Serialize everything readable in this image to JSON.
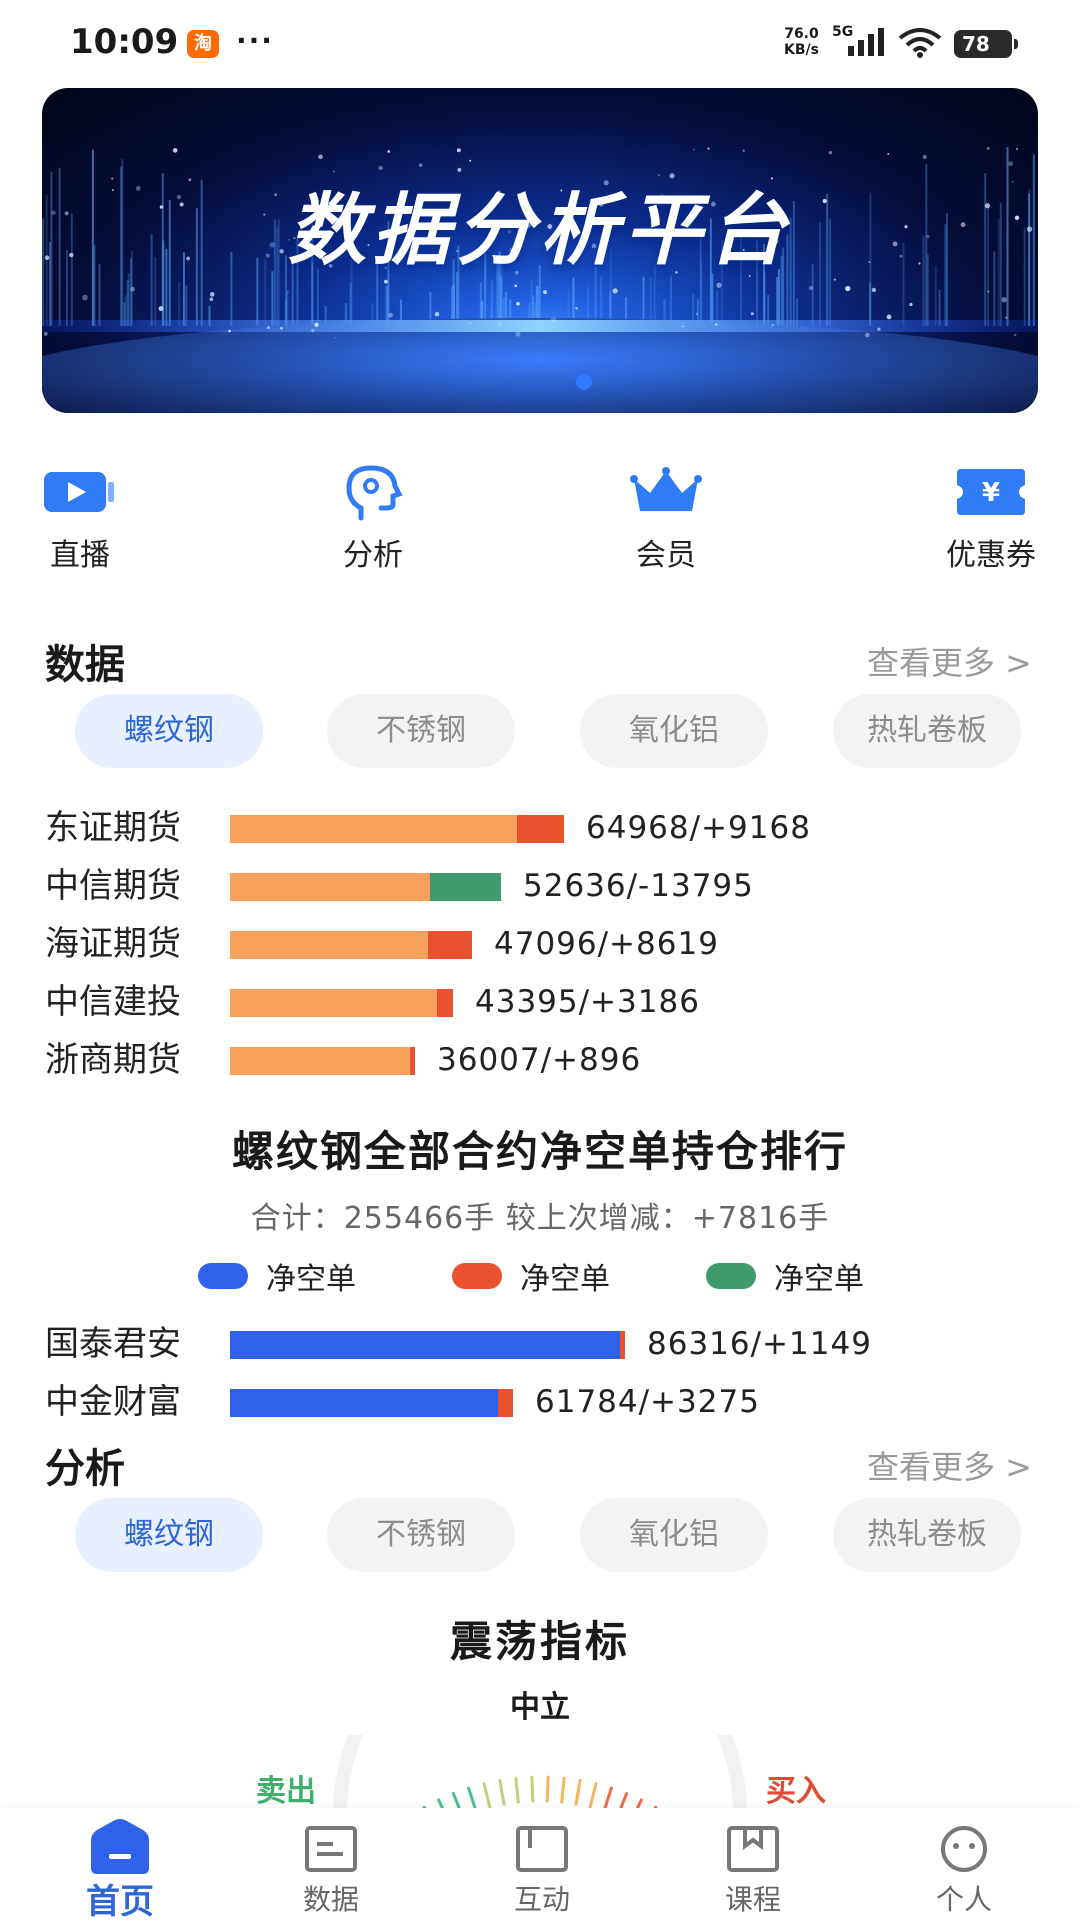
{
  "status_bar": {
    "time": "10:09",
    "app_badge": "淘",
    "more": "···",
    "net_speed": "76.0",
    "net_unit": "KB/s",
    "net_type": "5G",
    "battery": "78"
  },
  "banner": {
    "title": "数据分析平台"
  },
  "quick_actions": [
    {
      "label": "直播",
      "icon": "live-video-icon"
    },
    {
      "label": "分析",
      "icon": "analysis-head-icon"
    },
    {
      "label": "会员",
      "icon": "crown-icon"
    },
    {
      "label": "优惠券",
      "icon": "coupon-icon"
    }
  ],
  "data_section": {
    "title": "数据",
    "more": "查看更多 >",
    "chips": [
      "螺纹钢",
      "不锈钢",
      "氧化铝",
      "热轧卷板"
    ],
    "active_chip": 0,
    "long_rows": [
      {
        "name": "东证期货",
        "value": "64968/+9168",
        "total": 64968,
        "change": 9168
      },
      {
        "name": "中信期货",
        "value": "52636/-13795",
        "total": 52636,
        "change": -13795
      },
      {
        "name": "海证期货",
        "value": "47096/+8619",
        "total": 47096,
        "change": 8619
      },
      {
        "name": "中信建投",
        "value": "43395/+3186",
        "total": 43395,
        "change": 3186
      },
      {
        "name": "浙商期货",
        "value": "36007/+896",
        "total": 36007,
        "change": 896
      }
    ],
    "rank_title": "螺纹钢全部合约净空单持仓排行",
    "rank_summary": "合计：255466手  较上次增减：+7816手",
    "legend": [
      {
        "label": "净空单",
        "color": "#2f62e8"
      },
      {
        "label": "净空单",
        "color": "#e9522f"
      },
      {
        "label": "净空单",
        "color": "#3f9a6e"
      }
    ],
    "short_rows": [
      {
        "name": "国泰君安",
        "value": "86316/+1149",
        "total": 86316,
        "change": 1149
      },
      {
        "name": "中金财富",
        "value": "61784/+3275",
        "total": 61784,
        "change": 3275
      }
    ]
  },
  "analysis_section": {
    "title": "分析",
    "more": "查看更多 >",
    "chips": [
      "螺纹钢",
      "不锈钢",
      "氧化铝",
      "热轧卷板"
    ],
    "active_chip": 0,
    "oscillator_title": "震荡指标",
    "state": "中立",
    "sell_label": "卖出",
    "buy_label": "买入"
  },
  "bottom_nav": [
    {
      "label": "首页",
      "icon": "home-icon",
      "active": true
    },
    {
      "label": "数据",
      "icon": "data-doc-icon",
      "active": false
    },
    {
      "label": "互动",
      "icon": "interact-icon",
      "active": false
    },
    {
      "label": "课程",
      "icon": "course-bookmark-icon",
      "active": false
    },
    {
      "label": "个人",
      "icon": "profile-face-icon",
      "active": false
    }
  ],
  "colors": {
    "accent": "#2e66d6",
    "bar_orange": "#f7a15c",
    "increase_red": "#e9522f",
    "decrease_green": "#3f9a6e",
    "short_blue": "#2f62e8"
  }
}
